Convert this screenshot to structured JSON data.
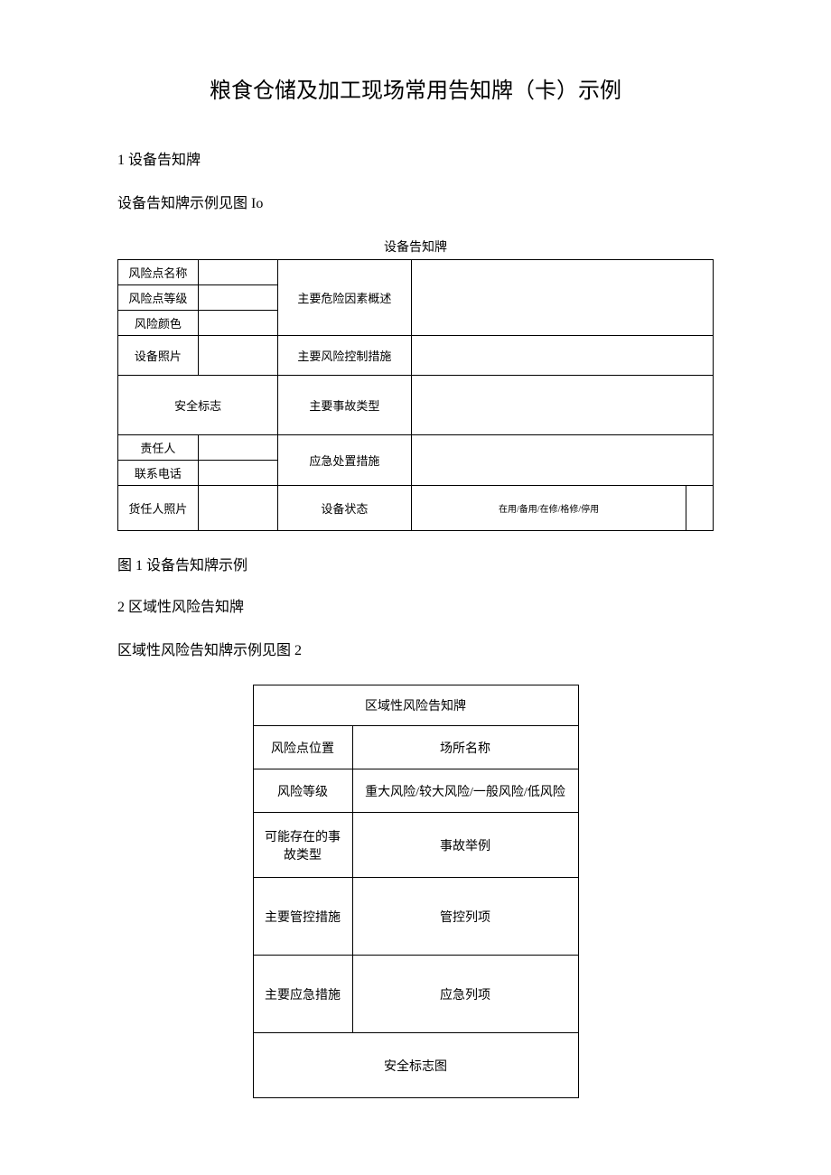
{
  "title": "粮食仓储及加工现场常用告知牌（卡）示例",
  "section1": {
    "heading": "1 设备告知牌",
    "text": "设备告知牌示例见图 Io",
    "table_caption": "设备告知牌",
    "rows": {
      "risk_point_name": "风险点名称",
      "risk_point_level": "风险点等级",
      "risk_color": "风险颜色",
      "main_hazard_overview": "主要危险因素概述",
      "equipment_photo": "设备照片",
      "safety_sign": "安全标志",
      "main_risk_control": "主要风险控制措施",
      "main_accident_type": "主要事故类型",
      "responsible_person": "责任人",
      "contact_phone": "联系电话",
      "responsible_photo": "货任人照片",
      "emergency_measures": "应急处置措施",
      "equipment_status": "设备状态",
      "status_value": "在用/备用/在修/格修/停用"
    },
    "caption_below": "图 1 设备告知牌示例"
  },
  "section2": {
    "heading": "2 区域性风险告知牌",
    "text": "区域性风险告知牌示例见图 2",
    "table_header": "区域性风险告知牌",
    "rows": {
      "risk_location": "风险点位置",
      "place_name": "场所名称",
      "risk_level": "风险等级",
      "risk_level_value": "重大风险/较大风险/一般风险/低风险",
      "accident_type": "可能存在的事故类型",
      "accident_example": "事故举例",
      "control_measures": "主要管控措施",
      "control_items": "管控列项",
      "emergency_measures": "主要应急措施",
      "emergency_items": "应急列项",
      "safety_sign_diagram": "安全标志图"
    }
  }
}
